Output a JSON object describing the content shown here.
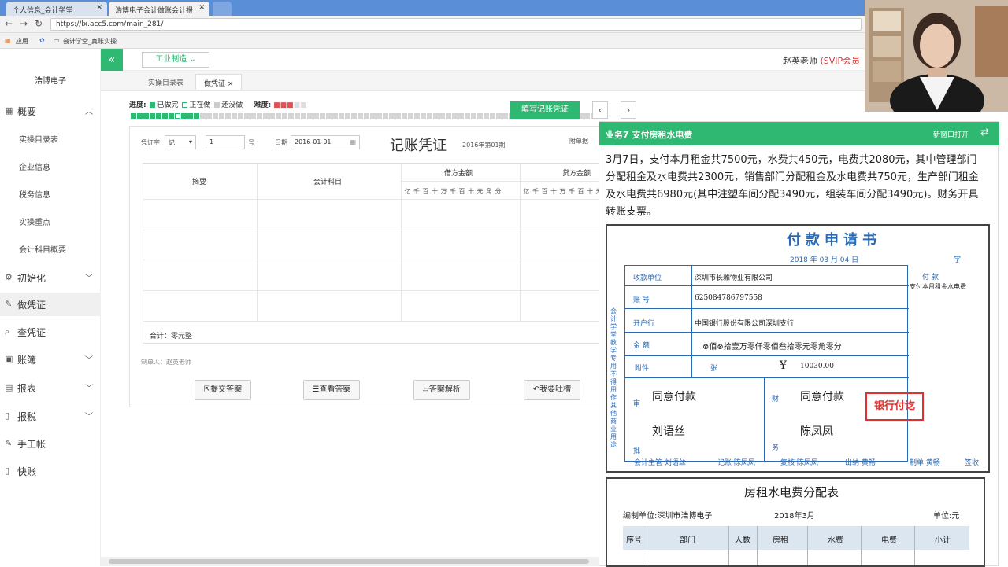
{
  "browser": {
    "tabs": [
      {
        "label": "个人信息_会计学堂"
      },
      {
        "label": "浩博电子会计做账会计报"
      }
    ],
    "url": "https://lx.acc5.com/main_281/",
    "bookmarks": [
      {
        "label": "应用"
      },
      {
        "label": "会计学堂_真账实操"
      }
    ]
  },
  "sidebar": {
    "company": "浩博电子",
    "items": [
      {
        "label": "概要",
        "icon": "grid-icon",
        "chevron": "^"
      },
      {
        "label": "初始化",
        "icon": "gear-icon",
        "chevron": "v"
      },
      {
        "label": "做凭证",
        "icon": "pen-icon",
        "chevron": ""
      },
      {
        "label": "查凭证",
        "icon": "search-icon",
        "chevron": ""
      },
      {
        "label": "账簿",
        "icon": "folder-icon",
        "chevron": "v"
      },
      {
        "label": "报表",
        "icon": "table-icon",
        "chevron": "v"
      },
      {
        "label": "报税",
        "icon": "doc-icon",
        "chevron": "v"
      },
      {
        "label": "手工帐",
        "icon": "pen-icon",
        "chevron": ""
      },
      {
        "label": "快账",
        "icon": "doc-icon",
        "chevron": ""
      }
    ],
    "subitems": [
      {
        "label": "实操目录表"
      },
      {
        "label": "企业信息"
      },
      {
        "label": "税务信息"
      },
      {
        "label": "实操重点"
      },
      {
        "label": "会计科目概要"
      }
    ]
  },
  "topbar": {
    "collapse_icon": "«",
    "industry": "工业制造",
    "teacher": "赵英老师",
    "vip": "(SVIP会员"
  },
  "pagetabs": [
    {
      "label": "实操目录表"
    },
    {
      "label": "做凭证",
      "close": "×"
    }
  ],
  "progress": {
    "label": "进度:",
    "done": "已做完",
    "doing": "正在做",
    "todo": "还没做",
    "difficulty": "难度:",
    "write_btn": "填写记账凭证",
    "prev": "‹",
    "next": "›"
  },
  "voucher": {
    "word_label": "凭证字",
    "word_value": "记",
    "number": "1",
    "number_suffix": "号",
    "date_label": "日期",
    "date_value": "2016-01-01",
    "title": "记账凭证",
    "period": "2016年第01期",
    "attach_label": "附单据",
    "col_summary": "摘要",
    "col_account": "会计科目",
    "col_debit": "借方金额",
    "col_credit": "贷方金额",
    "digits": [
      "亿",
      "千",
      "百",
      "十",
      "万",
      "千",
      "百",
      "十",
      "元",
      "角",
      "分"
    ],
    "total": "合计：零元整",
    "maker": "制单人：赵英老师"
  },
  "actions": [
    {
      "label": "提交答案",
      "icon": "export-icon"
    },
    {
      "label": "查看答案",
      "icon": "database-icon"
    },
    {
      "label": "答案解析",
      "icon": "folder-open-icon"
    },
    {
      "label": "我要吐槽",
      "icon": "reply-icon"
    }
  ],
  "panel": {
    "title": "业务7 支付房租水电费",
    "open_new": "新窗口打开",
    "switch_icon": "⇄",
    "description": "3月7日，支付本月租金共7500元，水费共450元，电费共2080元，其中管理部门分配租金及水电费共2300元，销售部门分配租金及水电费共750元，生产部门租金及水电费共6980元(其中注塑车间分配3490元，组装车间分配3490元)。财务开具转账支票。"
  },
  "doc1": {
    "title": "付款申请书",
    "date": "2018 年   03 月   04 日",
    "zi": "字",
    "side_text": "会计学堂教学专用 不得用作其他商业用途",
    "labels": {
      "payee": "收款单位",
      "account": "账      号",
      "bank": "开户行",
      "amount": "金      额",
      "attach": "附件",
      "zhang": "张",
      "purpose": "付    款",
      "shen": "审",
      "pi": "批",
      "cai": "财",
      "wu": "务"
    },
    "values": {
      "payee": "深圳市长雅物业有限公司",
      "account": "625084786797558",
      "bank": "中国银行股份有限公司深圳支行",
      "amount_words": "⊗佰⊗拾壹万零仟零佰叁拾零元零角零分",
      "amount_symbol": "¥",
      "amount_num": "10030.00",
      "purpose": "支付本月租金水电费",
      "approve1": "同意付款",
      "approve2": "同意付款",
      "signer1": "刘语丝",
      "signer2": "陈凤凤"
    },
    "stamp": "银行付讫",
    "footer": [
      "会计主管  刘语丝",
      "记账 陈凤凤",
      "复核 陈凤凤",
      "出纳 黄畅",
      "制单 黄畅",
      "签收"
    ]
  },
  "doc2": {
    "title": "房租水电费分配表",
    "unit_label": "编制单位:深圳市浩博电子",
    "period": "2018年3月",
    "currency": "单位:元",
    "columns": [
      "序号",
      "部门",
      "人数",
      "房租",
      "水费",
      "电费",
      "小计"
    ]
  }
}
